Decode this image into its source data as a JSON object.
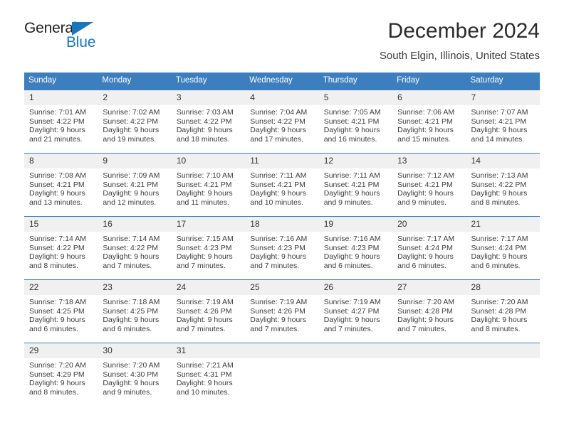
{
  "brand": {
    "name_primary": "General",
    "name_secondary": "Blue",
    "accent_color": "#1b75bb"
  },
  "header": {
    "title": "December 2024",
    "subtitle": "South Elgin, Illinois, United States"
  },
  "calendar": {
    "header_background": "#3d7ebf",
    "daynum_background": "#f0f0f0",
    "weekday_headers": [
      "Sunday",
      "Monday",
      "Tuesday",
      "Wednesday",
      "Thursday",
      "Friday",
      "Saturday"
    ],
    "weeks": [
      [
        {
          "day": "1",
          "sunrise": "Sunrise: 7:01 AM",
          "sunset": "Sunset: 4:22 PM",
          "daylight_line1": "Daylight: 9 hours",
          "daylight_line2": "and 21 minutes."
        },
        {
          "day": "2",
          "sunrise": "Sunrise: 7:02 AM",
          "sunset": "Sunset: 4:22 PM",
          "daylight_line1": "Daylight: 9 hours",
          "daylight_line2": "and 19 minutes."
        },
        {
          "day": "3",
          "sunrise": "Sunrise: 7:03 AM",
          "sunset": "Sunset: 4:22 PM",
          "daylight_line1": "Daylight: 9 hours",
          "daylight_line2": "and 18 minutes."
        },
        {
          "day": "4",
          "sunrise": "Sunrise: 7:04 AM",
          "sunset": "Sunset: 4:22 PM",
          "daylight_line1": "Daylight: 9 hours",
          "daylight_line2": "and 17 minutes."
        },
        {
          "day": "5",
          "sunrise": "Sunrise: 7:05 AM",
          "sunset": "Sunset: 4:21 PM",
          "daylight_line1": "Daylight: 9 hours",
          "daylight_line2": "and 16 minutes."
        },
        {
          "day": "6",
          "sunrise": "Sunrise: 7:06 AM",
          "sunset": "Sunset: 4:21 PM",
          "daylight_line1": "Daylight: 9 hours",
          "daylight_line2": "and 15 minutes."
        },
        {
          "day": "7",
          "sunrise": "Sunrise: 7:07 AM",
          "sunset": "Sunset: 4:21 PM",
          "daylight_line1": "Daylight: 9 hours",
          "daylight_line2": "and 14 minutes."
        }
      ],
      [
        {
          "day": "8",
          "sunrise": "Sunrise: 7:08 AM",
          "sunset": "Sunset: 4:21 PM",
          "daylight_line1": "Daylight: 9 hours",
          "daylight_line2": "and 13 minutes."
        },
        {
          "day": "9",
          "sunrise": "Sunrise: 7:09 AM",
          "sunset": "Sunset: 4:21 PM",
          "daylight_line1": "Daylight: 9 hours",
          "daylight_line2": "and 12 minutes."
        },
        {
          "day": "10",
          "sunrise": "Sunrise: 7:10 AM",
          "sunset": "Sunset: 4:21 PM",
          "daylight_line1": "Daylight: 9 hours",
          "daylight_line2": "and 11 minutes."
        },
        {
          "day": "11",
          "sunrise": "Sunrise: 7:11 AM",
          "sunset": "Sunset: 4:21 PM",
          "daylight_line1": "Daylight: 9 hours",
          "daylight_line2": "and 10 minutes."
        },
        {
          "day": "12",
          "sunrise": "Sunrise: 7:11 AM",
          "sunset": "Sunset: 4:21 PM",
          "daylight_line1": "Daylight: 9 hours",
          "daylight_line2": "and 9 minutes."
        },
        {
          "day": "13",
          "sunrise": "Sunrise: 7:12 AM",
          "sunset": "Sunset: 4:21 PM",
          "daylight_line1": "Daylight: 9 hours",
          "daylight_line2": "and 9 minutes."
        },
        {
          "day": "14",
          "sunrise": "Sunrise: 7:13 AM",
          "sunset": "Sunset: 4:22 PM",
          "daylight_line1": "Daylight: 9 hours",
          "daylight_line2": "and 8 minutes."
        }
      ],
      [
        {
          "day": "15",
          "sunrise": "Sunrise: 7:14 AM",
          "sunset": "Sunset: 4:22 PM",
          "daylight_line1": "Daylight: 9 hours",
          "daylight_line2": "and 8 minutes."
        },
        {
          "day": "16",
          "sunrise": "Sunrise: 7:14 AM",
          "sunset": "Sunset: 4:22 PM",
          "daylight_line1": "Daylight: 9 hours",
          "daylight_line2": "and 7 minutes."
        },
        {
          "day": "17",
          "sunrise": "Sunrise: 7:15 AM",
          "sunset": "Sunset: 4:23 PM",
          "daylight_line1": "Daylight: 9 hours",
          "daylight_line2": "and 7 minutes."
        },
        {
          "day": "18",
          "sunrise": "Sunrise: 7:16 AM",
          "sunset": "Sunset: 4:23 PM",
          "daylight_line1": "Daylight: 9 hours",
          "daylight_line2": "and 7 minutes."
        },
        {
          "day": "19",
          "sunrise": "Sunrise: 7:16 AM",
          "sunset": "Sunset: 4:23 PM",
          "daylight_line1": "Daylight: 9 hours",
          "daylight_line2": "and 6 minutes."
        },
        {
          "day": "20",
          "sunrise": "Sunrise: 7:17 AM",
          "sunset": "Sunset: 4:24 PM",
          "daylight_line1": "Daylight: 9 hours",
          "daylight_line2": "and 6 minutes."
        },
        {
          "day": "21",
          "sunrise": "Sunrise: 7:17 AM",
          "sunset": "Sunset: 4:24 PM",
          "daylight_line1": "Daylight: 9 hours",
          "daylight_line2": "and 6 minutes."
        }
      ],
      [
        {
          "day": "22",
          "sunrise": "Sunrise: 7:18 AM",
          "sunset": "Sunset: 4:25 PM",
          "daylight_line1": "Daylight: 9 hours",
          "daylight_line2": "and 6 minutes."
        },
        {
          "day": "23",
          "sunrise": "Sunrise: 7:18 AM",
          "sunset": "Sunset: 4:25 PM",
          "daylight_line1": "Daylight: 9 hours",
          "daylight_line2": "and 6 minutes."
        },
        {
          "day": "24",
          "sunrise": "Sunrise: 7:19 AM",
          "sunset": "Sunset: 4:26 PM",
          "daylight_line1": "Daylight: 9 hours",
          "daylight_line2": "and 7 minutes."
        },
        {
          "day": "25",
          "sunrise": "Sunrise: 7:19 AM",
          "sunset": "Sunset: 4:26 PM",
          "daylight_line1": "Daylight: 9 hours",
          "daylight_line2": "and 7 minutes."
        },
        {
          "day": "26",
          "sunrise": "Sunrise: 7:19 AM",
          "sunset": "Sunset: 4:27 PM",
          "daylight_line1": "Daylight: 9 hours",
          "daylight_line2": "and 7 minutes."
        },
        {
          "day": "27",
          "sunrise": "Sunrise: 7:20 AM",
          "sunset": "Sunset: 4:28 PM",
          "daylight_line1": "Daylight: 9 hours",
          "daylight_line2": "and 7 minutes."
        },
        {
          "day": "28",
          "sunrise": "Sunrise: 7:20 AM",
          "sunset": "Sunset: 4:28 PM",
          "daylight_line1": "Daylight: 9 hours",
          "daylight_line2": "and 8 minutes."
        }
      ],
      [
        {
          "day": "29",
          "sunrise": "Sunrise: 7:20 AM",
          "sunset": "Sunset: 4:29 PM",
          "daylight_line1": "Daylight: 9 hours",
          "daylight_line2": "and 8 minutes."
        },
        {
          "day": "30",
          "sunrise": "Sunrise: 7:20 AM",
          "sunset": "Sunset: 4:30 PM",
          "daylight_line1": "Daylight: 9 hours",
          "daylight_line2": "and 9 minutes."
        },
        {
          "day": "31",
          "sunrise": "Sunrise: 7:21 AM",
          "sunset": "Sunset: 4:31 PM",
          "daylight_line1": "Daylight: 9 hours",
          "daylight_line2": "and 10 minutes."
        },
        {
          "day": "",
          "sunrise": "",
          "sunset": "",
          "daylight_line1": "",
          "daylight_line2": ""
        },
        {
          "day": "",
          "sunrise": "",
          "sunset": "",
          "daylight_line1": "",
          "daylight_line2": ""
        },
        {
          "day": "",
          "sunrise": "",
          "sunset": "",
          "daylight_line1": "",
          "daylight_line2": ""
        },
        {
          "day": "",
          "sunrise": "",
          "sunset": "",
          "daylight_line1": "",
          "daylight_line2": ""
        }
      ]
    ]
  }
}
